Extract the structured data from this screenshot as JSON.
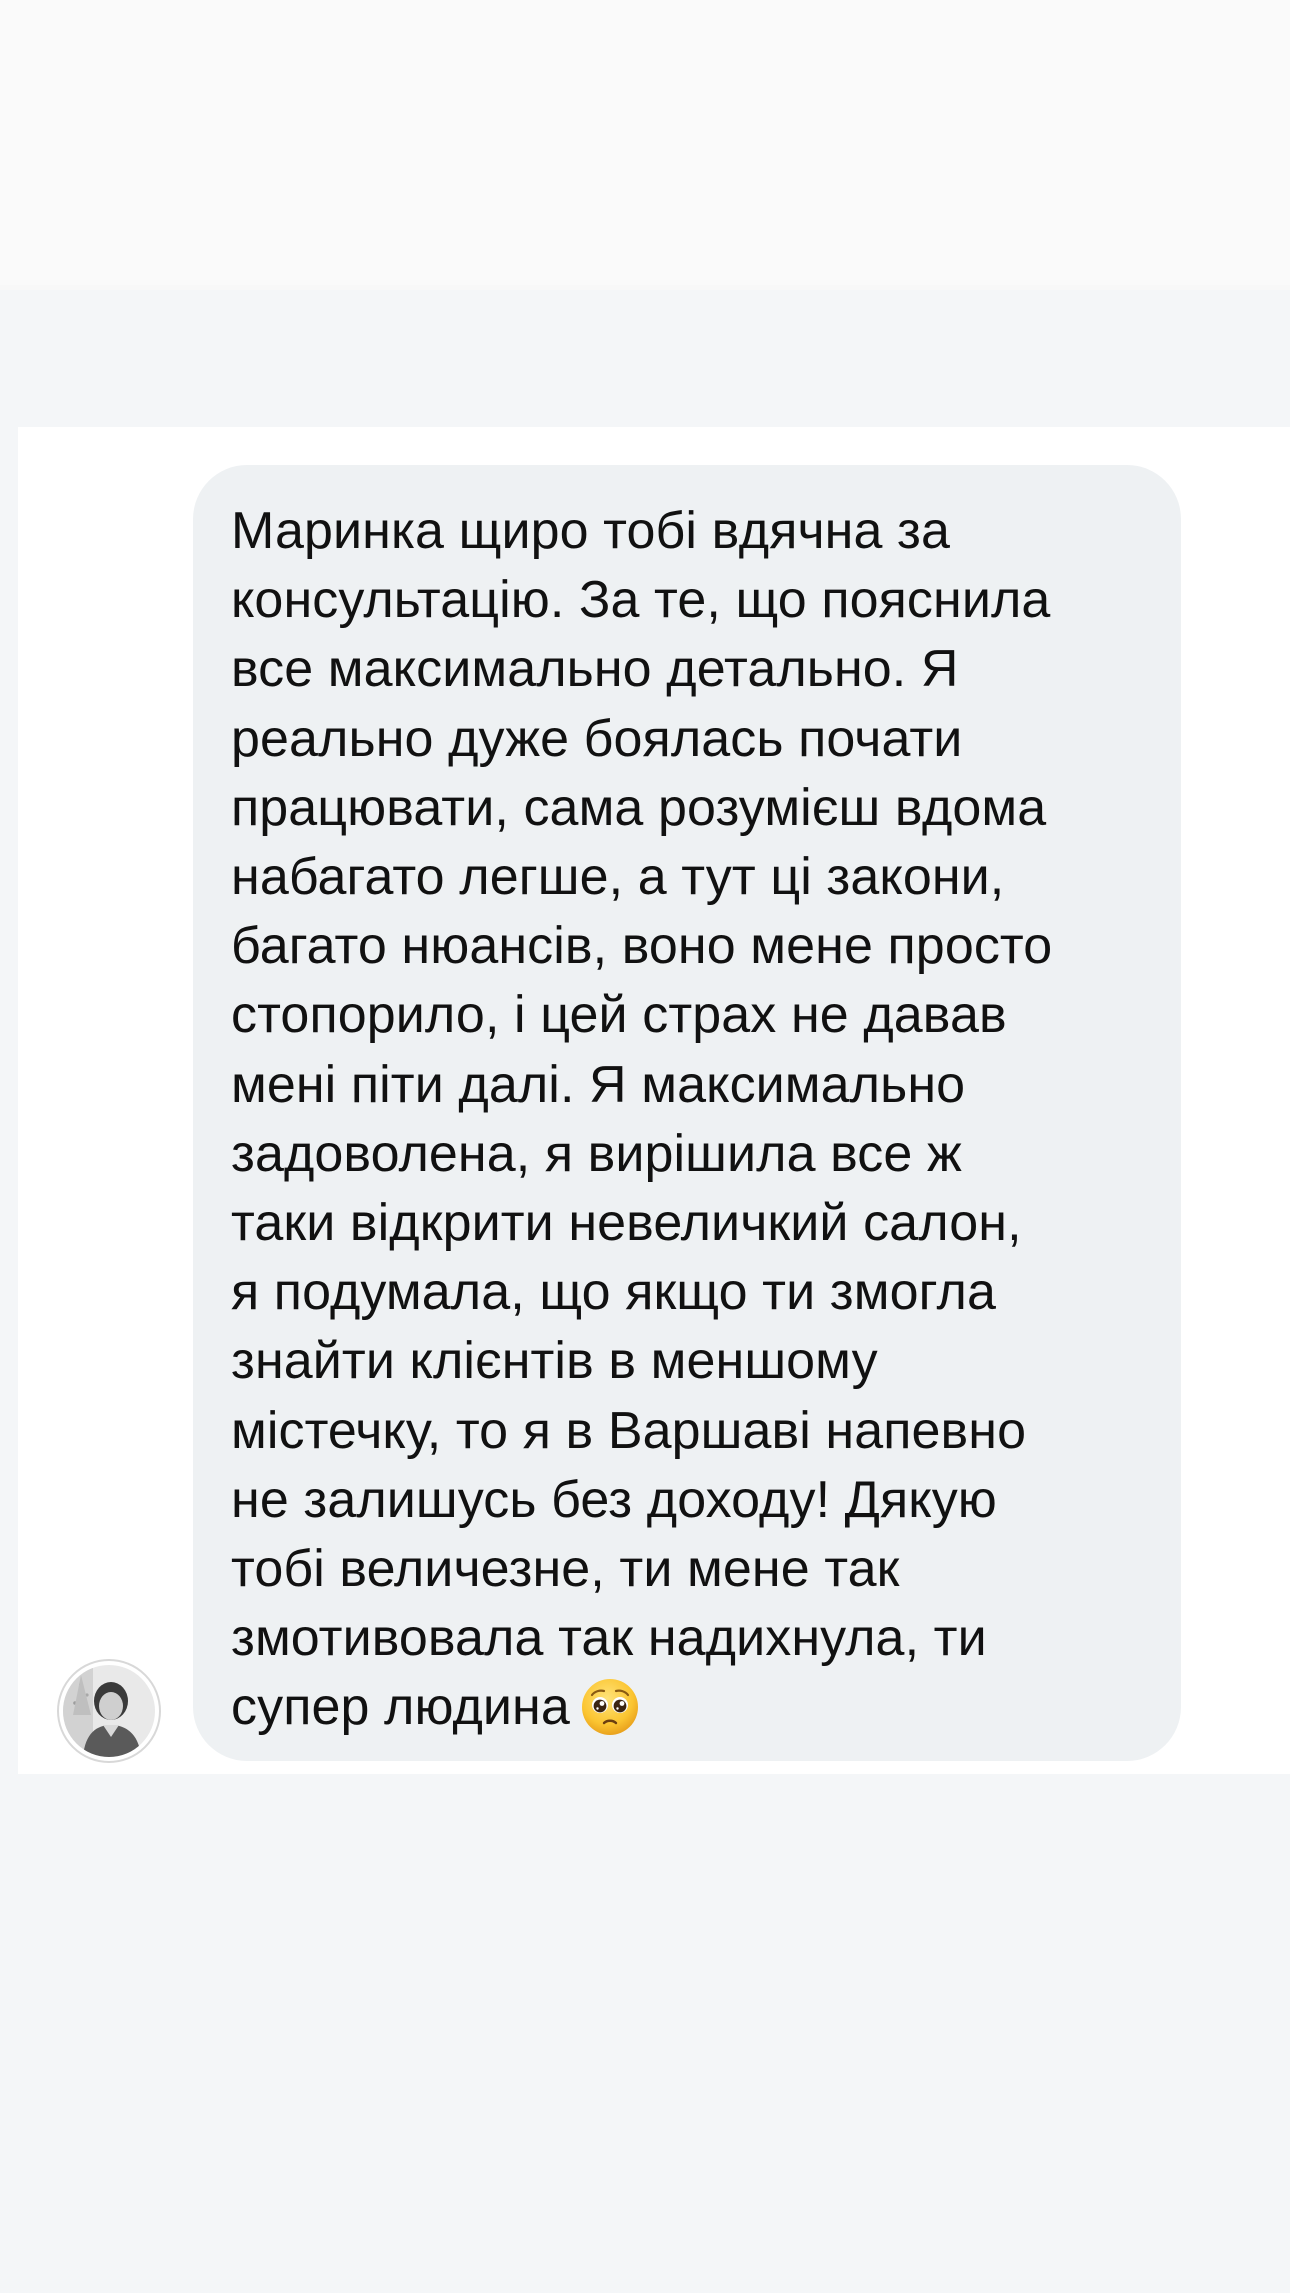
{
  "thread": {
    "messages": [
      {
        "direction": "incoming",
        "text": "Маринка щиро тобі вдячна за\nконсультацію. За те, що пояснила\nвсе максимально детально. Я\nреально дуже боялась почати\nпрацювати, сама розумієш вдома\nнабагато легше, а тут ці закони,\nбагато нюансів, воно мене просто\nстопорило, і цей страх не давав\nмені піти далі. Я максимально\nзадоволена, я вирішила все ж\nтаки відкрити невеличкий салон,\nя подумала, що якщо ти змогла\nзнайти клієнтів в меншому\nмістечку, то я в Варшаві напевно\nне залишусь без доходу! Дякую\nтобі величезне, ти мене так\nзмотивовала так надихнула, ти\nсупер людина",
        "emoji": "pleading-face-icon",
        "sender_avatar": "avatar-photo"
      }
    ]
  },
  "colors": {
    "page_background": "#f4f6f8",
    "top_band": "#fafafa",
    "panel_background": "#ffffff",
    "bubble_background": "#eef1f3",
    "text": "#111111"
  }
}
